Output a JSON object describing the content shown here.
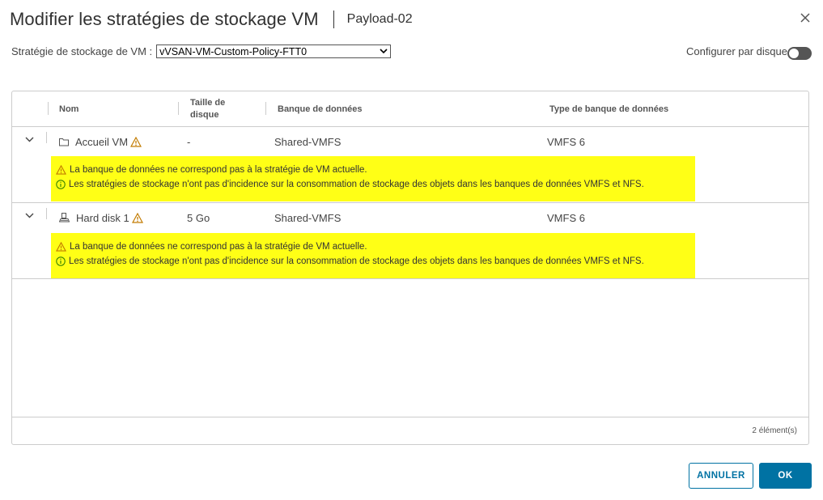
{
  "dialog": {
    "title": "Modifier les stratégies de stockage VM",
    "subtitle": "Payload-02",
    "close_icon": "close-icon"
  },
  "policy": {
    "label": "Stratégie de stockage de VM :",
    "selected": "vVSAN-VM-Custom-Policy-FTT0"
  },
  "per_disk": {
    "label": "Configurer par disque",
    "enabled": false
  },
  "grid": {
    "columns": [
      "Nom",
      "Taille de disque",
      "Banque de données",
      "Type de banque de données"
    ],
    "rows": [
      {
        "name": "Accueil VM",
        "icon": "folder-icon",
        "size": "-",
        "datastore": "Shared-VMFS",
        "datastore_type": "VMFS 6",
        "warning": "La banque de données ne correspond pas à la stratégie de VM actuelle.",
        "info": "Les stratégies de stockage n'ont pas d'incidence sur la consommation de stockage des objets dans les banques de données VMFS et NFS."
      },
      {
        "name": "Hard disk 1",
        "icon": "hard-disk-icon",
        "size": "5 Go",
        "datastore": "Shared-VMFS",
        "datastore_type": "VMFS 6",
        "warning": "La banque de données ne correspond pas à la stratégie de VM actuelle.",
        "info": "Les stratégies de stockage n'ont pas d'incidence sur la consommation de stockage des objets dans les banques de données VMFS et NFS."
      }
    ],
    "footer": "2 élément(s)"
  },
  "buttons": {
    "cancel": "ANNULER",
    "ok": "OK"
  },
  "colors": {
    "accent": "#0072a3",
    "banner": "#ffff16",
    "warning": "#c27b00",
    "info": "#3c8500"
  }
}
